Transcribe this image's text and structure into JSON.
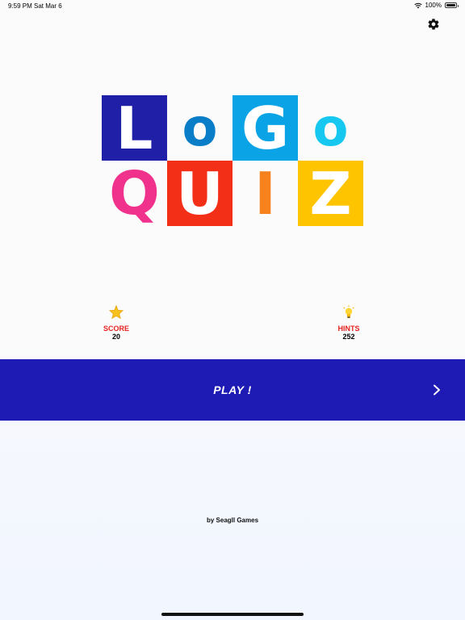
{
  "status_bar": {
    "time": "9:59 PM",
    "date": "Sat Mar 6",
    "battery": "100%"
  },
  "logo": {
    "row1": [
      "L",
      "o",
      "G",
      "o"
    ],
    "row2": [
      "Q",
      "U",
      "I",
      "Z"
    ],
    "colors": {
      "L_tile": "#1f1fa8",
      "o1": "#0a7dc9",
      "G_tile": "#0aa3e6",
      "o2": "#16c8ef",
      "Q": "#f0328c",
      "U_tile": "#f32f18",
      "I": "#f7811c",
      "Z_tile": "#ffc400"
    }
  },
  "stats": {
    "score": {
      "label": "SCORE",
      "value": "20",
      "icon": "star-icon"
    },
    "hints": {
      "label": "HINTS",
      "value": "252",
      "icon": "lightbulb-icon"
    }
  },
  "play_button": {
    "label": "PLAY !",
    "color": "#1e1ab4"
  },
  "credit": "by Seagll Games"
}
